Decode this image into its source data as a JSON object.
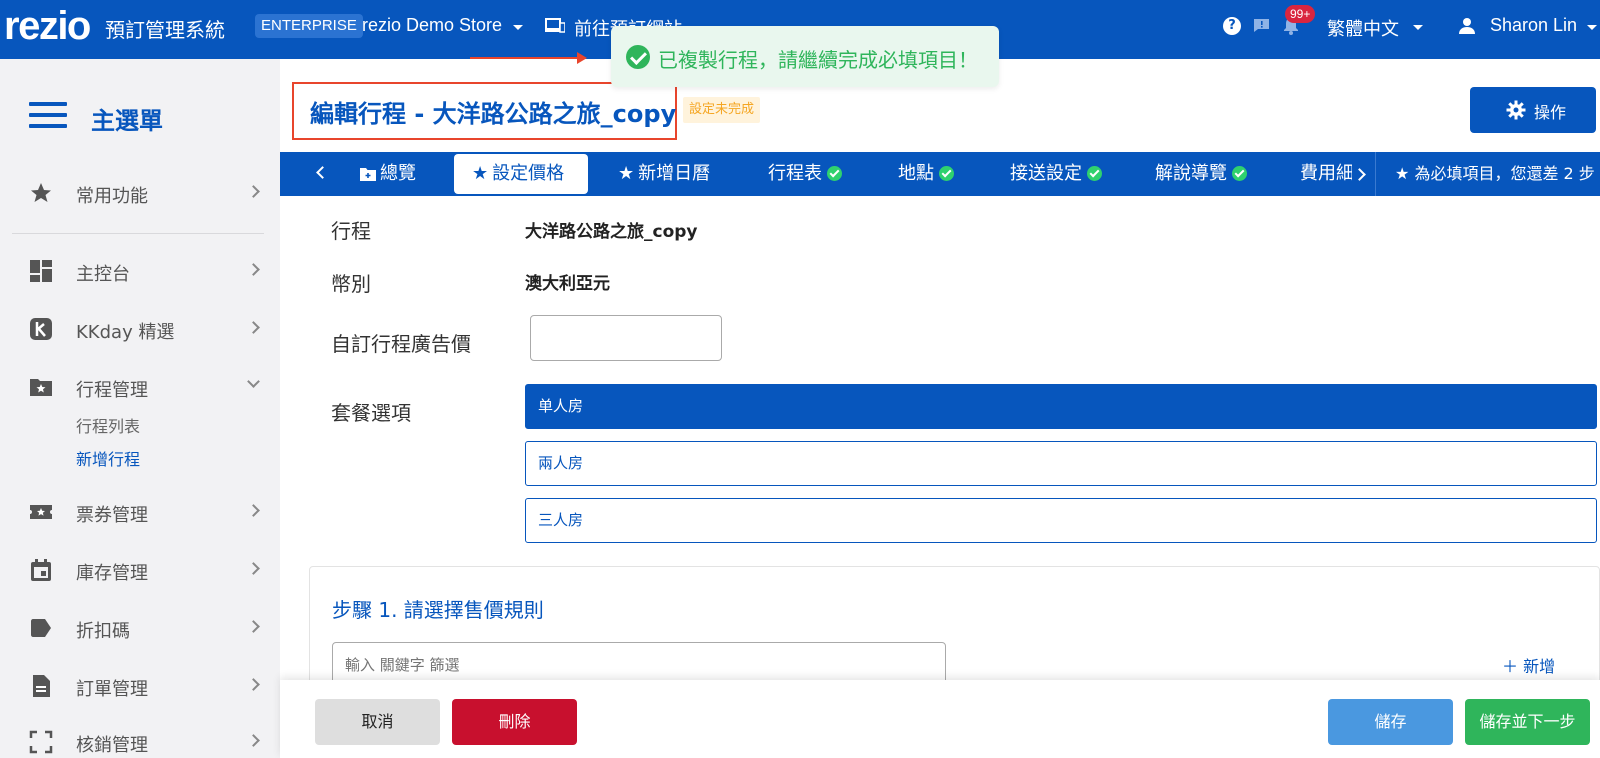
{
  "topbar": {
    "logo": "rezio",
    "app_title": "預訂管理系統",
    "plan_badge": "ENTERPRISE",
    "store_name": "rezio Demo Store",
    "site_link": "前往預訂網站",
    "notif_count": "99+",
    "language": "繁體中文",
    "user_name": "Sharon Lin"
  },
  "toast": {
    "message": "已複製行程，請繼續完成必填項目！"
  },
  "sidebar": {
    "title": "主選單",
    "items": [
      {
        "label": "常用功能",
        "icon": "star-icon"
      },
      {
        "label": "主控台",
        "icon": "dashboard-icon"
      },
      {
        "label": "KKday 精選",
        "icon": "kkday-icon"
      },
      {
        "label": "行程管理",
        "icon": "folder-star-icon"
      },
      {
        "label": "票券管理",
        "icon": "ticket-icon"
      },
      {
        "label": "庫存管理",
        "icon": "calendar-icon"
      },
      {
        "label": "折扣碼",
        "icon": "tag-icon"
      },
      {
        "label": "訂單管理",
        "icon": "document-icon"
      },
      {
        "label": "核銷管理",
        "icon": "scan-icon"
      }
    ],
    "sub_items": [
      {
        "label": "行程列表"
      },
      {
        "label": "新增行程"
      }
    ]
  },
  "header": {
    "page_title": "編輯行程 - 大洋路公路之旅_copy",
    "status_badge": "設定未完成",
    "ops_button": "操作"
  },
  "tabs": {
    "items": [
      {
        "label": "總覽"
      },
      {
        "label": "設定價格"
      },
      {
        "label": "新增日曆"
      },
      {
        "label": "行程表"
      },
      {
        "label": "地點"
      },
      {
        "label": "接送設定"
      },
      {
        "label": "解說導覽"
      },
      {
        "label": "費用細"
      }
    ],
    "note": "為必填項目，您還差 2 步"
  },
  "form": {
    "tour_label": "行程",
    "tour_value": "大洋路公路之旅_copy",
    "currency_label": "幣別",
    "currency_value": "澳大利亞元",
    "ad_price_label": "自訂行程廣告價",
    "ad_price_value": "",
    "package_label": "套餐選項",
    "packages": [
      {
        "label": "单人房",
        "selected": true
      },
      {
        "label": "兩人房",
        "selected": false
      },
      {
        "label": "三人房",
        "selected": false
      }
    ]
  },
  "step": {
    "title": "步驟 1. 請選擇售價規則",
    "filter_placeholder": "輸入 關鍵字 篩選",
    "add_label": "＋ 新增"
  },
  "footer": {
    "cancel": "取消",
    "delete": "刪除",
    "save": "儲存",
    "save_next": "儲存並下一步"
  },
  "colors": {
    "primary": "#0756bd",
    "success": "#2fb55b",
    "danger": "#c8102e",
    "highlight": "#e8452c"
  }
}
